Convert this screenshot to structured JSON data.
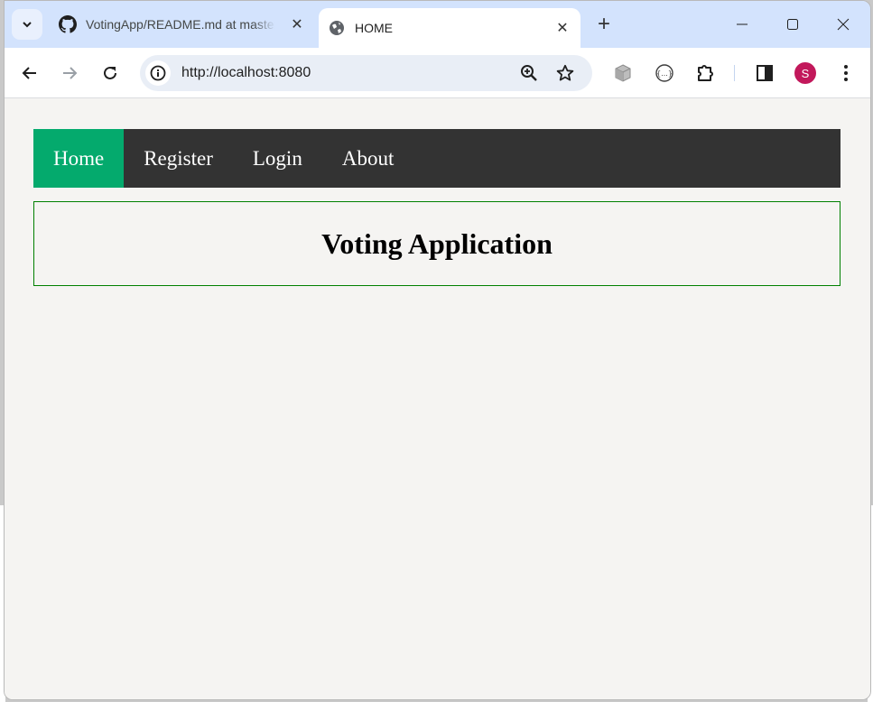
{
  "browser": {
    "tabs": [
      {
        "title": "VotingApp/README.md at master",
        "favicon": "github-icon",
        "active": false
      },
      {
        "title": "HOME",
        "favicon": "globe-icon",
        "active": true
      }
    ],
    "new_tab_label": "+",
    "address_bar": {
      "url": "http://localhost:8080"
    },
    "profile_initial": "S",
    "colors": {
      "tabstrip": "#d3e3fd",
      "avatar": "#c2185b"
    }
  },
  "page": {
    "nav": {
      "items": [
        {
          "label": "Home",
          "active": true
        },
        {
          "label": "Register",
          "active": false
        },
        {
          "label": "Login",
          "active": false
        },
        {
          "label": "About",
          "active": false
        }
      ],
      "colors": {
        "bar": "#333333",
        "active": "#04aa6d",
        "text": "#ffffff"
      }
    },
    "title": "Voting Application",
    "colors": {
      "title_border": "#008000",
      "background": "#f5f4f2"
    }
  }
}
